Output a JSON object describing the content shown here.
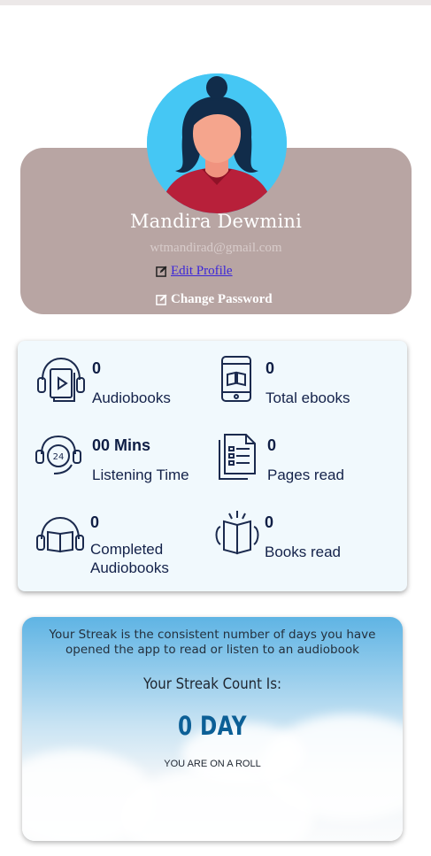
{
  "profile": {
    "name": "Mandira Dewmini",
    "email": "wtmandirad@gmail.com",
    "edit_profile_label": "Edit Profile",
    "change_password_label": "Change Password",
    "avatar_icon": "woman-avatar-icon",
    "card_color": "#b8a5a3",
    "avatar_bg_color": "#45c7f4"
  },
  "stats": {
    "audiobooks": {
      "value": "0",
      "label": "Audiobooks",
      "icon": "headphone-book-icon"
    },
    "total_ebooks": {
      "value": "0",
      "label": "Total ebooks",
      "icon": "tablet-book-icon"
    },
    "listening_time": {
      "value": "00 Mins",
      "label": "Listening Time",
      "icon": "headset-24h-icon"
    },
    "pages_read": {
      "value": "0",
      "label": "Pages read",
      "icon": "document-pages-icon"
    },
    "completed_audiobooks": {
      "value": "0",
      "label_line1": "Completed",
      "label_line2": "Audiobooks",
      "icon": "headphone-open-book-icon"
    },
    "books_read": {
      "value": "0",
      "label": "Books read",
      "icon": "open-book-read-icon"
    }
  },
  "streak": {
    "description": "Your Streak is the consistent number of days you have opened the app to read or listen to an audiobook",
    "title": "Your Streak Count Is:",
    "count": "0 DAY",
    "message": "YOU ARE ON A ROLL",
    "count_color": "#0c5f96"
  }
}
